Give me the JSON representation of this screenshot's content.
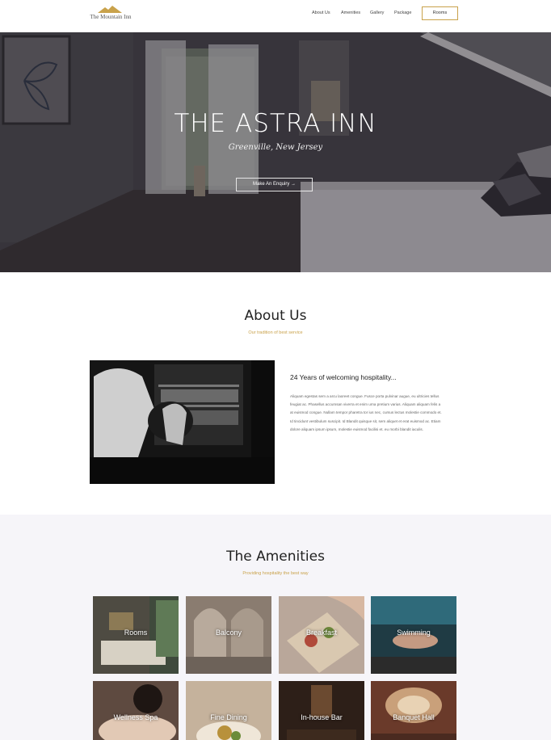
{
  "header": {
    "logo_text": "The Mountain Inn",
    "nav": [
      "About Us",
      "Amenities",
      "Gallery",
      "Package"
    ],
    "rooms_button": "Rooms",
    "accent": "#c9a24b"
  },
  "hero": {
    "title": "THE ASTRA INN",
    "subtitle": "Greenville, New Jersey",
    "button": "Make An Enquiry →"
  },
  "about": {
    "title": "About Us",
    "tagline": "Our tradition of best service",
    "heading": "24 Years of welcoming hospitality...",
    "body": "Aliquam egestas sem a arcu laoreet congue. Fusce porta pulvinar augue, eu ultricies tellus feugiat ac. Phasellus accumsan viverra et enim urna pretium varius. Aliquam aliquam felis a at euismod congue. Nullam tempor pharetra tor ius nec, cursus lectus molestie commodo et. Id tincidunt vestibulum suscipit. Id Blandit quisque sit, sem aliquet et erat euismod ac. Etiam dolore aliquam ipsum ipsum, molestie euismod facilisi et. eu morbi blandit iaculis."
  },
  "amenities": {
    "title": "The Amenities",
    "tagline": "Providing hospitality the best way",
    "items": [
      "Rooms",
      "Balcony",
      "Breakfast",
      "Swimming",
      "Wellness Spa",
      "Fine Dining",
      "In-house Bar",
      "Banquet Hall"
    ]
  }
}
